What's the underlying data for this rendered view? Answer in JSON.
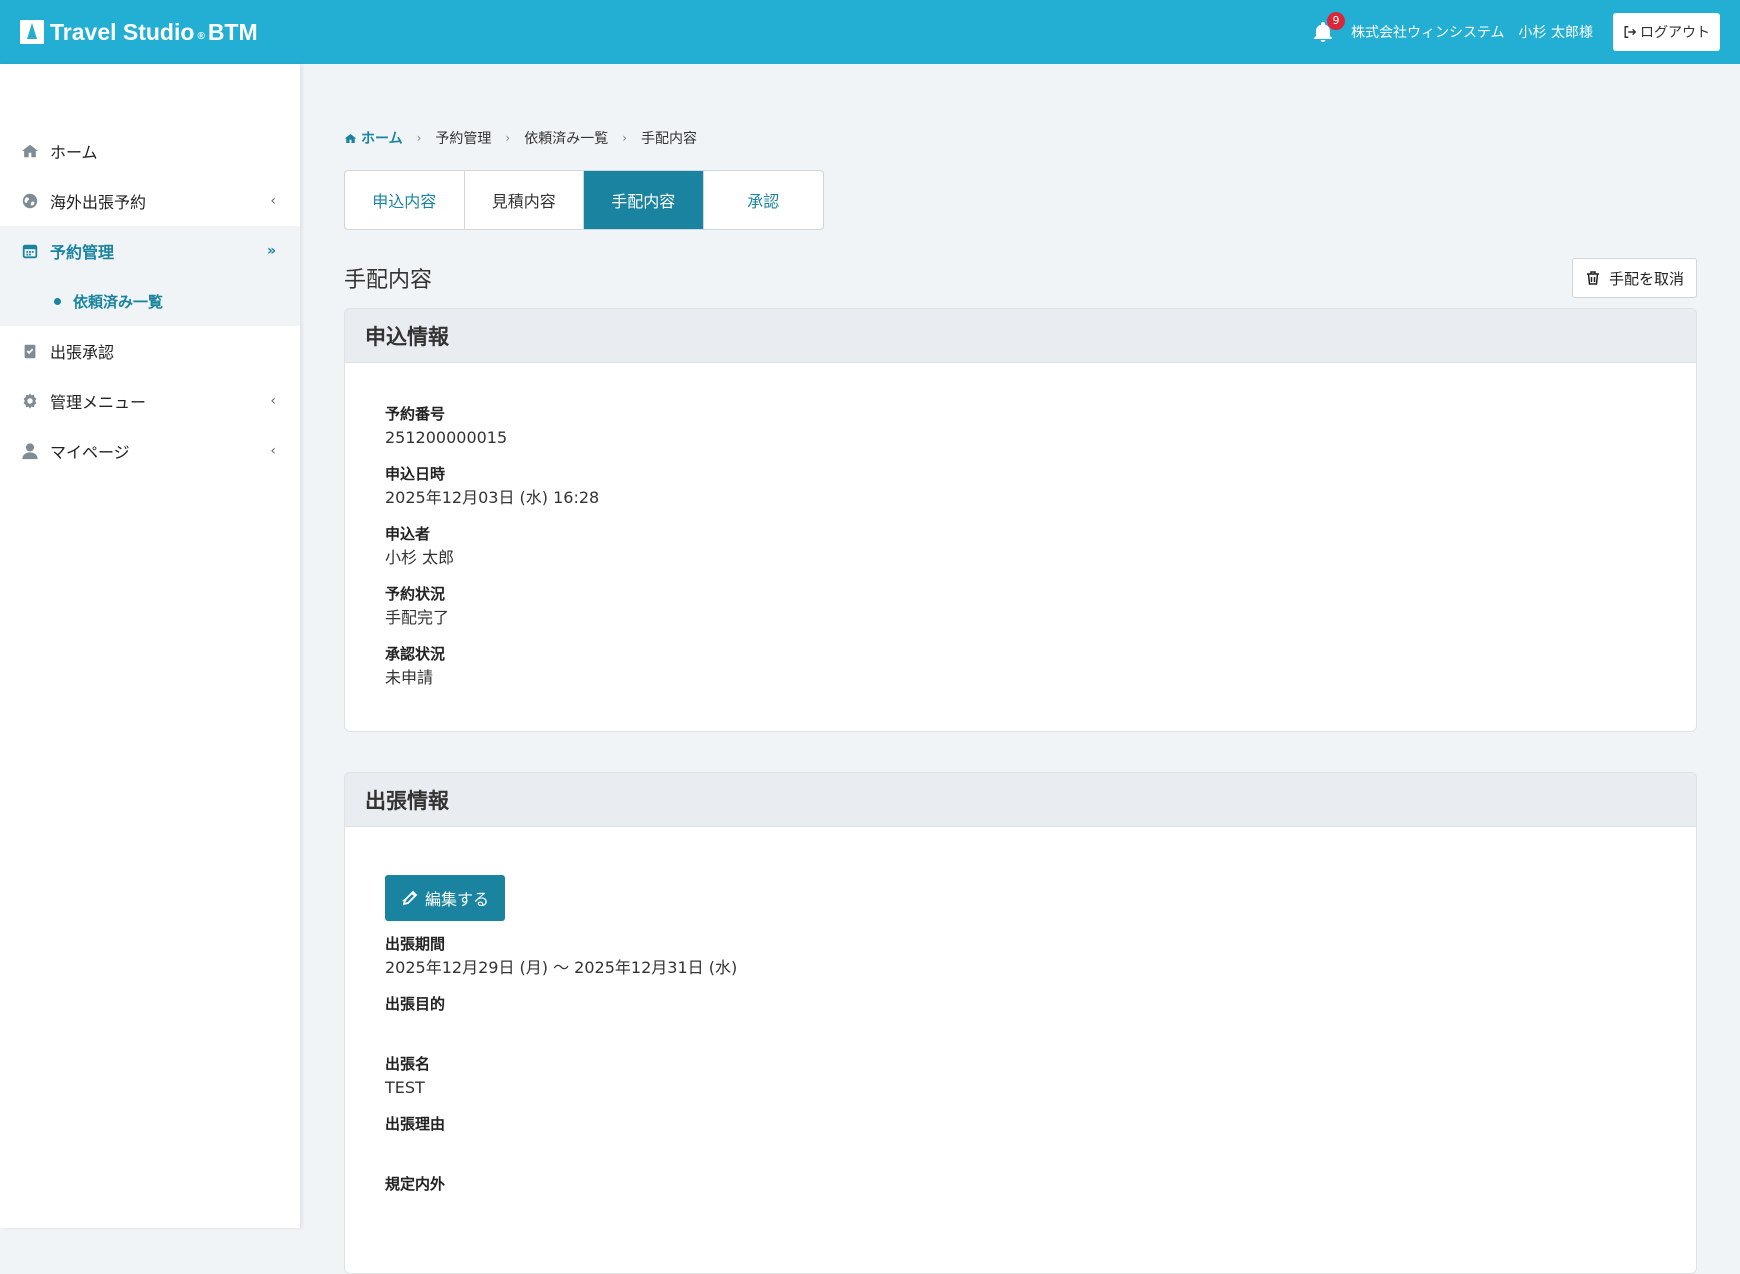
{
  "header": {
    "logo_text": "Travel Studio",
    "logo_reg": "®",
    "logo_suffix": "BTM",
    "notification_count": "9",
    "company": "株式会社ウィンシステム",
    "user": "小杉 太郎様",
    "logout_label": "ログアウト"
  },
  "sidebar": {
    "items": [
      {
        "label": "ホーム",
        "icon": "home-icon"
      },
      {
        "label": "海外出張予約",
        "icon": "globe-icon"
      },
      {
        "label": "予約管理",
        "icon": "calendar-icon"
      },
      {
        "label": "依頼済み一覧"
      },
      {
        "label": "出張承認",
        "icon": "clipboard-check-icon"
      },
      {
        "label": "管理メニュー",
        "icon": "gear-icon"
      },
      {
        "label": "マイページ",
        "icon": "user-icon"
      }
    ]
  },
  "breadcrumb": {
    "home": "ホーム",
    "b1": "予約管理",
    "b2": "依頼済み一覧",
    "b3": "手配内容"
  },
  "tabs": [
    "申込内容",
    "見積内容",
    "手配内容",
    "承認"
  ],
  "page_title": "手配内容",
  "cancel_label": "手配を取消",
  "application": {
    "title": "申込情報",
    "fields": [
      {
        "label": "予約番号",
        "value": "251200000015"
      },
      {
        "label": "申込日時",
        "value": "2025年12月03日 (水) 16:28"
      },
      {
        "label": "申込者",
        "value": "小杉 太郎"
      },
      {
        "label": "予約状況",
        "value": "手配完了"
      },
      {
        "label": "承認状況",
        "value": "未申請"
      }
    ]
  },
  "trip": {
    "title": "出張情報",
    "edit_label": "編集する",
    "fields": [
      {
        "label": "出張期間",
        "value": "2025年12月29日 (月) 〜 2025年12月31日 (水)"
      },
      {
        "label": "出張目的",
        "value": ""
      },
      {
        "label": "出張名",
        "value": "TEST"
      },
      {
        "label": "出張理由",
        "value": ""
      },
      {
        "label": "規定内外",
        "value": ""
      }
    ]
  },
  "colors": {
    "header": "#23afd3",
    "accent": "#1a84a0",
    "badge": "#d9263b"
  }
}
